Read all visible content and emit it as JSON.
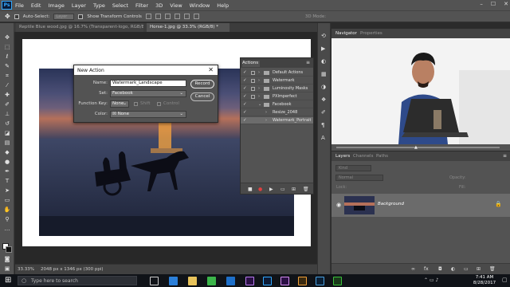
{
  "menubar": {
    "logo": "Ps",
    "items": [
      "File",
      "Edit",
      "Image",
      "Layer",
      "Type",
      "Select",
      "Filter",
      "3D",
      "View",
      "Window",
      "Help"
    ]
  },
  "options_bar": {
    "auto_select_label": "Auto-Select:",
    "auto_select_value": "Layer",
    "transform_label": "Show Transform Controls",
    "mode_label": "3D Mode:"
  },
  "tabs": [
    {
      "label": "Reptile Blue wood.jpg @ 16.7% (Transparent-logo, RGB/8) *",
      "active": false
    },
    {
      "label": "Horse-1.jpg @ 33.3% (RGB/8) *",
      "active": true
    }
  ],
  "status": {
    "zoom": "33.33%",
    "doc_info": "2048 px x 1346 px (300 ppi)"
  },
  "dialog": {
    "title": "New Action",
    "name_label": "Name:",
    "name_value": "Watermark_Landscape",
    "set_label": "Set:",
    "set_value": "Facebook",
    "function_key_label": "Function Key:",
    "function_key_value": "None",
    "shift_label": "Shift",
    "control_label": "Control",
    "color_label": "Color:",
    "color_value": "None",
    "record_button": "Record",
    "cancel_button": "Cancel"
  },
  "actions_panel": {
    "tab": "Actions",
    "rows": [
      {
        "label": "Default Actions",
        "type": "set",
        "expanded": false
      },
      {
        "label": "Watermark",
        "type": "set",
        "expanded": false
      },
      {
        "label": "Luminosity Masks",
        "type": "set",
        "expanded": false
      },
      {
        "label": "PXImperfect",
        "type": "set",
        "expanded": false
      },
      {
        "label": "Facebook",
        "type": "set",
        "expanded": true
      },
      {
        "label": "Resize_2048",
        "type": "action",
        "expanded": false
      },
      {
        "label": "Watermark_Portrait",
        "type": "action",
        "expanded": false
      }
    ]
  },
  "navigator": {
    "tabs": [
      "Navigator",
      "Properties"
    ]
  },
  "layers": {
    "tabs": [
      "Layers",
      "Channels",
      "Paths"
    ],
    "kind_placeholder": "Kind",
    "blend_mode": "Normal",
    "opacity_label": "Opacity:",
    "lock_label": "Lock:",
    "fill_label": "Fill:",
    "layer_name": "Background"
  },
  "taskbar": {
    "search_placeholder": "Type here to search",
    "time": "7:41 AM",
    "date": "8/28/2017"
  },
  "colors": {
    "ui_dark": "#535353",
    "accent_ps": "#31a8ff",
    "dialog_title_bg": "#ffffff"
  }
}
